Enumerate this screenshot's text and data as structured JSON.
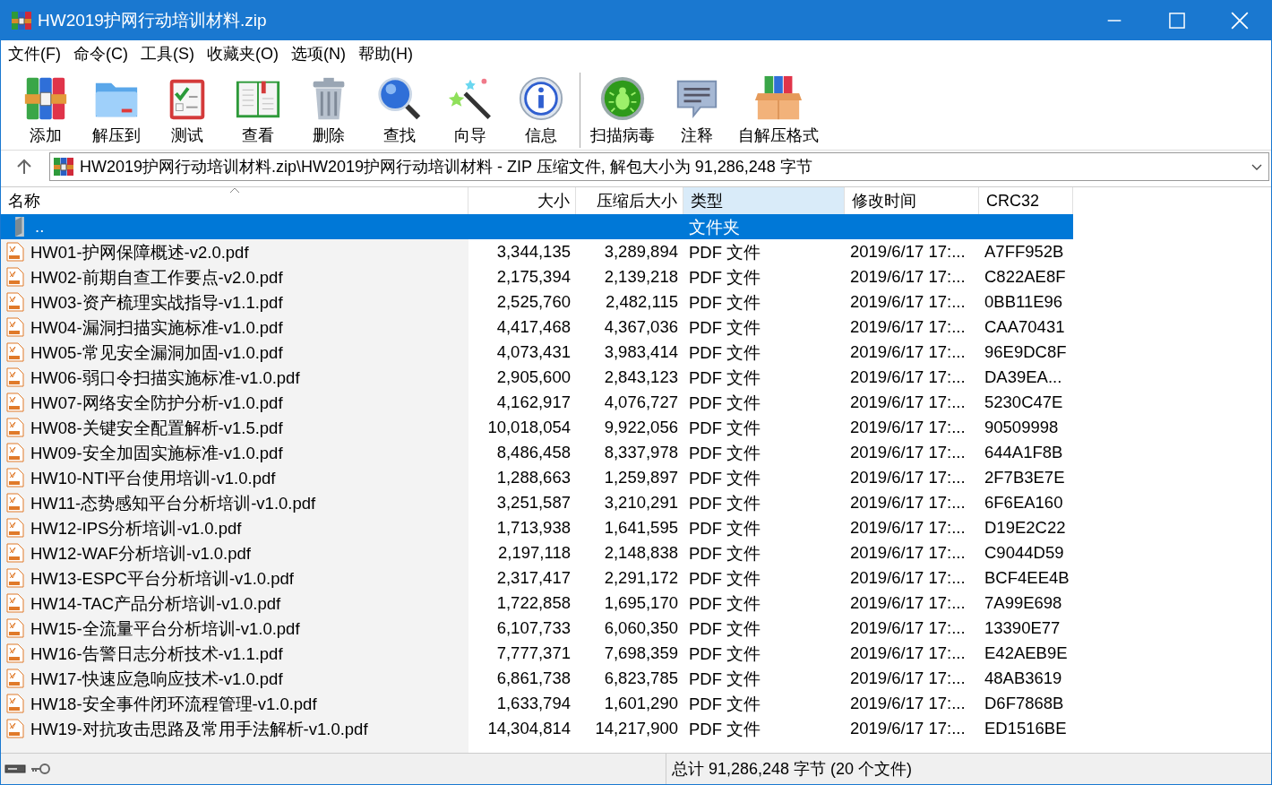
{
  "window": {
    "title": "HW2019护网行动培训材料.zip"
  },
  "menu": [
    "文件(F)",
    "命令(C)",
    "工具(S)",
    "收藏夹(O)",
    "选项(N)",
    "帮助(H)"
  ],
  "toolbar": {
    "groups": [
      [
        {
          "kind": "add",
          "label": "添加"
        },
        {
          "kind": "extract",
          "label": "解压到"
        },
        {
          "kind": "test",
          "label": "测试"
        },
        {
          "kind": "view",
          "label": "查看"
        },
        {
          "kind": "delete",
          "label": "删除"
        },
        {
          "kind": "find",
          "label": "查找"
        },
        {
          "kind": "wizard",
          "label": "向导"
        },
        {
          "kind": "info",
          "label": "信息"
        }
      ],
      [
        {
          "kind": "scan",
          "label": "扫描病毒"
        },
        {
          "kind": "comment",
          "label": "注释"
        },
        {
          "kind": "sfx",
          "label": "自解压格式"
        }
      ]
    ]
  },
  "address": {
    "path": "HW2019护网行动培训材料.zip\\HW2019护网行动培训材料 - ZIP 压缩文件, 解包大小为 91,286,248 字节"
  },
  "table": {
    "columns": [
      {
        "label": "名称",
        "sorted": true,
        "highlighted": false
      },
      {
        "label": "大小",
        "sorted": false,
        "highlighted": false
      },
      {
        "label": "压缩后大小",
        "sorted": false,
        "highlighted": false
      },
      {
        "label": "类型",
        "sorted": false,
        "highlighted": true
      },
      {
        "label": "修改时间",
        "sorted": false,
        "highlighted": false
      },
      {
        "label": "CRC32",
        "sorted": false,
        "highlighted": false
      }
    ],
    "rows": [
      {
        "kind": "folder",
        "selected": true,
        "cells": [
          "..",
          "",
          "",
          "文件夹",
          "",
          ""
        ]
      },
      {
        "kind": "pdf",
        "selected": false,
        "cells": [
          "HW01-护网保障概述-v2.0.pdf",
          "3,344,135",
          "3,289,894",
          "PDF 文件",
          "2019/6/17 17:...",
          "A7FF952B"
        ]
      },
      {
        "kind": "pdf",
        "selected": false,
        "cells": [
          "HW02-前期自查工作要点-v2.0.pdf",
          "2,175,394",
          "2,139,218",
          "PDF 文件",
          "2019/6/17 17:...",
          "C822AE8F"
        ]
      },
      {
        "kind": "pdf",
        "selected": false,
        "cells": [
          "HW03-资产梳理实战指导-v1.1.pdf",
          "2,525,760",
          "2,482,115",
          "PDF 文件",
          "2019/6/17 17:...",
          "0BB11E96"
        ]
      },
      {
        "kind": "pdf",
        "selected": false,
        "cells": [
          "HW04-漏洞扫描实施标准-v1.0.pdf",
          "4,417,468",
          "4,367,036",
          "PDF 文件",
          "2019/6/17 17:...",
          "CAA70431"
        ]
      },
      {
        "kind": "pdf",
        "selected": false,
        "cells": [
          "HW05-常见安全漏洞加固-v1.0.pdf",
          "4,073,431",
          "3,983,414",
          "PDF 文件",
          "2019/6/17 17:...",
          "96E9DC8F"
        ]
      },
      {
        "kind": "pdf",
        "selected": false,
        "cells": [
          "HW06-弱口令扫描实施标准-v1.0.pdf",
          "2,905,600",
          "2,843,123",
          "PDF 文件",
          "2019/6/17 17:...",
          "DA39EA..."
        ]
      },
      {
        "kind": "pdf",
        "selected": false,
        "cells": [
          "HW07-网络安全防护分析-v1.0.pdf",
          "4,162,917",
          "4,076,727",
          "PDF 文件",
          "2019/6/17 17:...",
          "5230C47E"
        ]
      },
      {
        "kind": "pdf",
        "selected": false,
        "cells": [
          "HW08-关键安全配置解析-v1.5.pdf",
          "10,018,054",
          "9,922,056",
          "PDF 文件",
          "2019/6/17 17:...",
          "90509998"
        ]
      },
      {
        "kind": "pdf",
        "selected": false,
        "cells": [
          "HW09-安全加固实施标准-v1.0.pdf",
          "8,486,458",
          "8,337,978",
          "PDF 文件",
          "2019/6/17 17:...",
          "644A1F8B"
        ]
      },
      {
        "kind": "pdf",
        "selected": false,
        "cells": [
          "HW10-NTI平台使用培训-v1.0.pdf",
          "1,288,663",
          "1,259,897",
          "PDF 文件",
          "2019/6/17 17:...",
          "2F7B3E7E"
        ]
      },
      {
        "kind": "pdf",
        "selected": false,
        "cells": [
          "HW11-态势感知平台分析培训-v1.0.pdf",
          "3,251,587",
          "3,210,291",
          "PDF 文件",
          "2019/6/17 17:...",
          "6F6EA160"
        ]
      },
      {
        "kind": "pdf",
        "selected": false,
        "cells": [
          "HW12-IPS分析培训-v1.0.pdf",
          "1,713,938",
          "1,641,595",
          "PDF 文件",
          "2019/6/17 17:...",
          "D19E2C22"
        ]
      },
      {
        "kind": "pdf",
        "selected": false,
        "cells": [
          "HW12-WAF分析培训-v1.0.pdf",
          "2,197,118",
          "2,148,838",
          "PDF 文件",
          "2019/6/17 17:...",
          "C9044D59"
        ]
      },
      {
        "kind": "pdf",
        "selected": false,
        "cells": [
          "HW13-ESPC平台分析培训-v1.0.pdf",
          "2,317,417",
          "2,291,172",
          "PDF 文件",
          "2019/6/17 17:...",
          "BCF4EE4B"
        ]
      },
      {
        "kind": "pdf",
        "selected": false,
        "cells": [
          "HW14-TAC产品分析培训-v1.0.pdf",
          "1,722,858",
          "1,695,170",
          "PDF 文件",
          "2019/6/17 17:...",
          "7A99E698"
        ]
      },
      {
        "kind": "pdf",
        "selected": false,
        "cells": [
          "HW15-全流量平台分析培训-v1.0.pdf",
          "6,107,733",
          "6,060,350",
          "PDF 文件",
          "2019/6/17 17:...",
          "13390E77"
        ]
      },
      {
        "kind": "pdf",
        "selected": false,
        "cells": [
          "HW16-告警日志分析技术-v1.1.pdf",
          "7,777,371",
          "7,698,359",
          "PDF 文件",
          "2019/6/17 17:...",
          "E42AEB9E"
        ]
      },
      {
        "kind": "pdf",
        "selected": false,
        "cells": [
          "HW17-快速应急响应技术-v1.0.pdf",
          "6,861,738",
          "6,823,785",
          "PDF 文件",
          "2019/6/17 17:...",
          "48AB3619"
        ]
      },
      {
        "kind": "pdf",
        "selected": false,
        "cells": [
          "HW18-安全事件闭环流程管理-v1.0.pdf",
          "1,633,794",
          "1,601,290",
          "PDF 文件",
          "2019/6/17 17:...",
          "D6F7868B"
        ]
      },
      {
        "kind": "pdf",
        "selected": false,
        "cells": [
          "HW19-对抗攻击思路及常用手法解析-v1.0.pdf",
          "14,304,814",
          "14,217,900",
          "PDF 文件",
          "2019/6/17 17:...",
          "ED1516BE"
        ]
      }
    ]
  },
  "status_bar": {
    "text": "总计 91,286,248 字节 (20 个文件)"
  }
}
